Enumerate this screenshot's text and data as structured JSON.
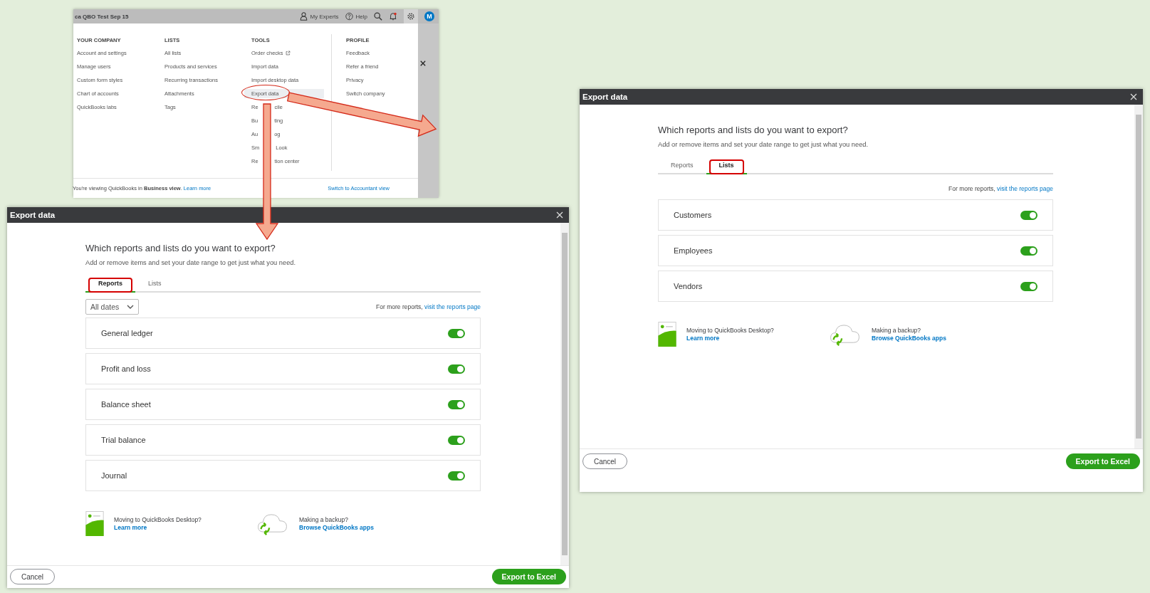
{
  "menu_screenshot": {
    "company": "ca QBO Test Sep 15",
    "top_links": [
      {
        "kind": "experts",
        "label": "My Experts"
      },
      {
        "kind": "help",
        "label": "Help"
      }
    ],
    "avatar": "M",
    "columns": [
      {
        "heading": "YOUR COMPANY",
        "items": [
          {
            "label": "Account and settings",
            "selected": false,
            "circled": false,
            "external": false
          },
          {
            "label": "Manage users",
            "selected": false,
            "circled": false,
            "external": false
          },
          {
            "label": "Custom form styles",
            "selected": false,
            "circled": false,
            "external": false
          },
          {
            "label": "Chart of accounts",
            "selected": false,
            "circled": false,
            "external": false
          },
          {
            "label": "QuickBooks labs",
            "selected": false,
            "circled": false,
            "external": false
          }
        ]
      },
      {
        "heading": "LISTS",
        "items": [
          {
            "label": "All lists",
            "selected": false,
            "circled": false,
            "external": false
          },
          {
            "label": "Products and services",
            "selected": false,
            "circled": false,
            "external": false
          },
          {
            "label": "Recurring transactions",
            "selected": false,
            "circled": false,
            "external": false
          },
          {
            "label": "Attachments",
            "selected": false,
            "circled": false,
            "external": false
          },
          {
            "label": "Tags",
            "selected": false,
            "circled": false,
            "external": false
          }
        ]
      },
      {
        "heading": "TOOLS",
        "items": [
          {
            "label": "Order checks",
            "selected": false,
            "circled": false,
            "external": true
          },
          {
            "label": "Import data",
            "selected": false,
            "circled": false,
            "external": false
          },
          {
            "label": "Import desktop data",
            "selected": false,
            "circled": false,
            "external": false
          },
          {
            "label": "Export data",
            "selected": true,
            "circled": true,
            "external": false
          },
          {
            "label": "Re",
            "label_end": "cile",
            "selected": false,
            "circled": false,
            "external": false
          },
          {
            "label": "Bu",
            "label_end": "ting",
            "selected": false,
            "circled": false,
            "external": false
          },
          {
            "label": "Au",
            "label_end": "og",
            "selected": false,
            "circled": false,
            "external": false
          },
          {
            "label": "Sm",
            "label_end": "Look",
            "selected": false,
            "circled": false,
            "external": false
          },
          {
            "label": "Re",
            "label_end": "tion center",
            "selected": false,
            "circled": false,
            "external": false
          }
        ]
      },
      {
        "heading": "PROFILE",
        "items": [
          {
            "label": "Feedback",
            "selected": false,
            "circled": false,
            "external": false
          },
          {
            "label": "Refer a friend",
            "selected": false,
            "circled": false,
            "external": false
          },
          {
            "label": "Privacy",
            "selected": false,
            "circled": false,
            "external": false
          },
          {
            "label": "Switch company",
            "selected": false,
            "circled": false,
            "external": false
          }
        ]
      }
    ],
    "footer_text": "You're viewing QuickBooks in **Business view**.",
    "footer_link": "Learn more",
    "switch_link": "Switch to Accountant view"
  },
  "dialogs": [
    {
      "title": "Export data",
      "heading": "Which reports and lists do you want to export?",
      "subtitle": "Add or remove items and set your date range to get just what you need.",
      "tabs": [
        {
          "label": "Reports",
          "selected": true,
          "circled": true
        },
        {
          "label": "Lists",
          "selected": false,
          "circled": false
        }
      ],
      "date_filter": "All dates",
      "more_prefix": "For more reports,",
      "more_link": "visit the reports page",
      "items": [
        {
          "label": "General ledger",
          "on": true
        },
        {
          "label": "Profit and loss",
          "on": true
        },
        {
          "label": "Balance sheet",
          "on": true
        },
        {
          "label": "Trial balance",
          "on": true
        },
        {
          "label": "Journal",
          "on": true
        }
      ],
      "promos": [
        {
          "kind": "desktop",
          "title": "Moving to QuickBooks Desktop?",
          "link": "Learn more"
        },
        {
          "kind": "backup",
          "title": "Making a backup?",
          "link": "Browse QuickBooks apps"
        }
      ],
      "cancel": "Cancel",
      "export": "Export to Excel"
    },
    {
      "title": "Export data",
      "heading": "Which reports and lists do you want to export?",
      "subtitle": "Add or remove items and set your date range to get just what you need.",
      "tabs": [
        {
          "label": "Reports",
          "selected": false,
          "circled": false
        },
        {
          "label": "Lists",
          "selected": true,
          "circled": true
        }
      ],
      "more_prefix": "For more reports,",
      "more_link": "visit the reports page",
      "items": [
        {
          "label": "Customers",
          "on": true
        },
        {
          "label": "Employees",
          "on": true
        },
        {
          "label": "Vendors",
          "on": true
        }
      ],
      "promos": [
        {
          "kind": "desktop",
          "title": "Moving to QuickBooks Desktop?",
          "link": "Learn more"
        },
        {
          "kind": "backup",
          "title": "Making a backup?",
          "link": "Browse QuickBooks apps"
        }
      ],
      "cancel": "Cancel",
      "export": "Export to Excel"
    }
  ]
}
